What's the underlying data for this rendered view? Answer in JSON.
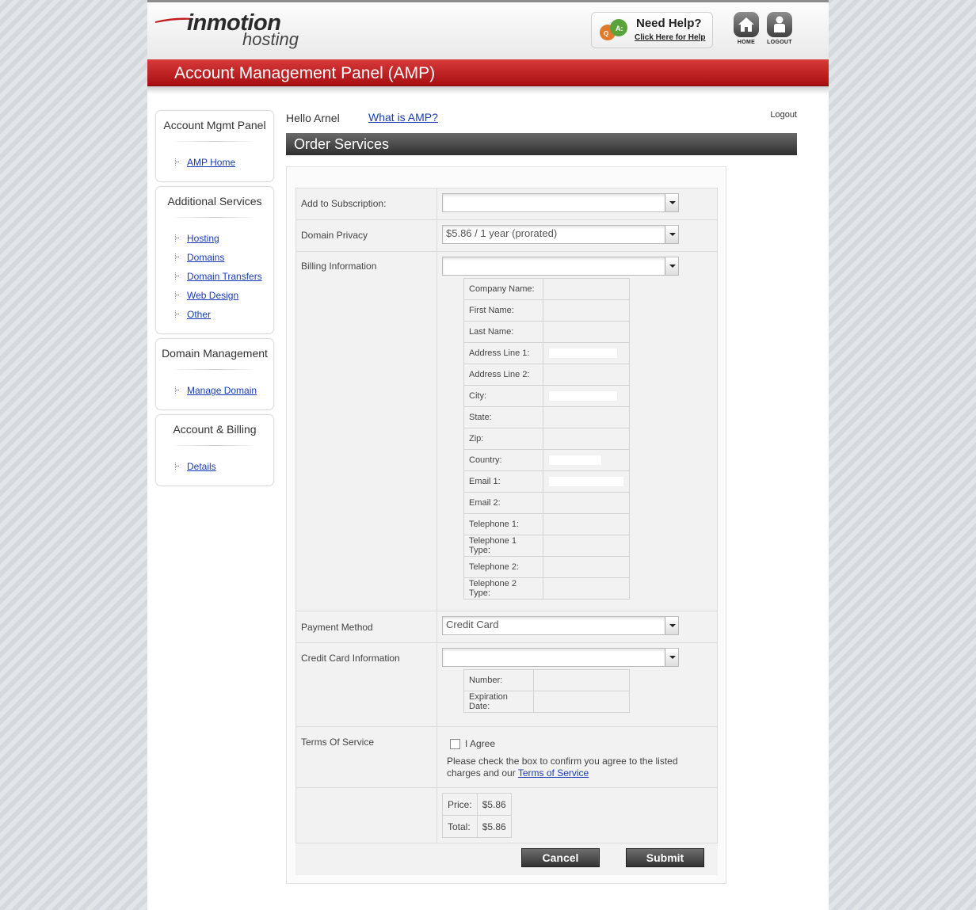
{
  "header": {
    "brand_main": "inmotion",
    "brand_sub": "hosting",
    "help_title": "Need Help?",
    "help_link": "Click Here for Help",
    "home_label": "HOME",
    "logout_label": "LOGOUT",
    "panel_title": "Account Management Panel (AMP)"
  },
  "sidebar": {
    "sections": [
      {
        "title": "Account Mgmt Panel",
        "items": [
          "AMP Home"
        ]
      },
      {
        "title": "Additional Services",
        "items": [
          "Hosting",
          "Domains",
          "Domain Transfers",
          "Web Design",
          "Other"
        ]
      },
      {
        "title": "Domain Management",
        "items": [
          "Manage Domain"
        ]
      },
      {
        "title": "Account & Billing",
        "items": [
          "Details"
        ]
      }
    ]
  },
  "main": {
    "greeting": "Hello Arnel",
    "what_is": "What is AMP?",
    "logout": "Logout",
    "section_title": "Order Services"
  },
  "form": {
    "add_subscription_label": "Add to Subscription:",
    "add_subscription_value": "",
    "domain_privacy_label": "Domain Privacy",
    "domain_privacy_value": "$5.86 / 1 year (prorated)",
    "billing_label": "Billing Information",
    "billing_value": "",
    "billing_fields": [
      "Company Name:",
      "First Name:",
      "Last Name:",
      "Address Line 1:",
      "Address Line 2:",
      "City:",
      "State:",
      "Zip:",
      "Country:",
      "Email 1:",
      "Email 2:",
      "Telephone 1:",
      "Telephone 1 Type:",
      "Telephone 2:",
      "Telephone 2 Type:"
    ],
    "payment_label": "Payment Method",
    "payment_value": "Credit Card",
    "cc_label": "Credit Card Information",
    "cc_value": "",
    "cc_fields": [
      "Number:",
      "Expiration Date:"
    ],
    "tos_label": "Terms Of Service",
    "agree_label": "I Agree",
    "tos_note": "Please check the box to confirm you agree to the listed charges and our",
    "tos_link": "Terms of Service",
    "price_label": "Price:",
    "price_value": "$5.86",
    "total_label": "Total:",
    "total_value": "$5.86",
    "cancel": "Cancel",
    "submit": "Submit"
  },
  "colors": {
    "brand_red": "#c41e23",
    "link_blue": "#1a3bb8",
    "dark_bar": "#3a3a3a"
  }
}
